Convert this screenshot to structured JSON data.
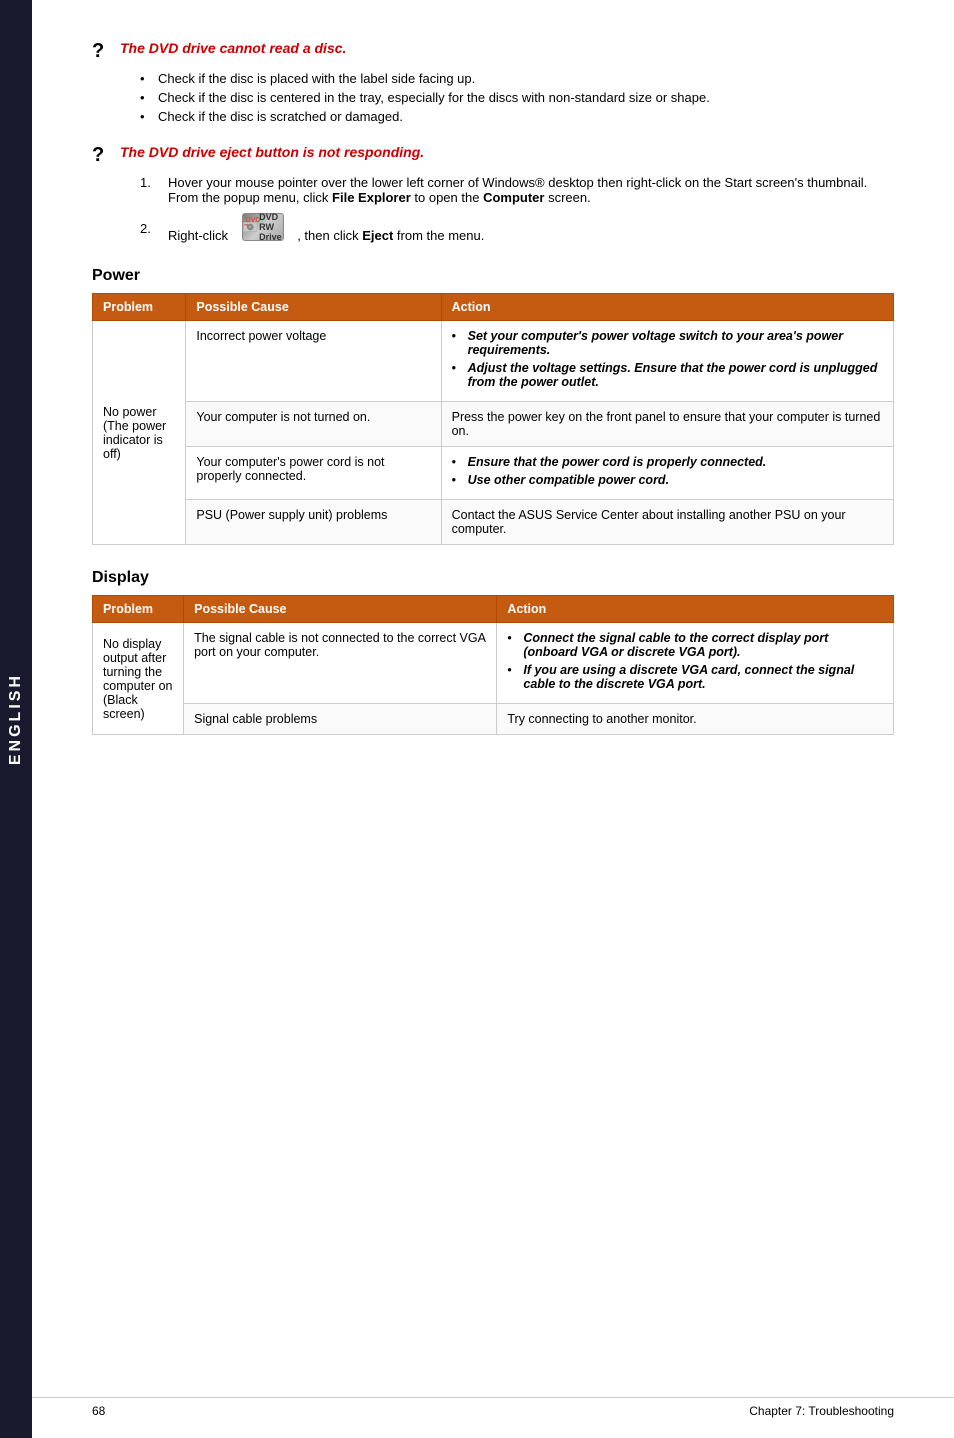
{
  "sidebar": {
    "label": "ENGLISH"
  },
  "dvd_cannot_read": {
    "question_mark": "?",
    "title": "The DVD drive cannot read a disc.",
    "bullets": [
      "Check if the disc is placed with the label side facing up.",
      "Check if the disc is centered in the tray, especially for the discs with non-standard size or shape.",
      "Check if the disc is scratched or damaged."
    ]
  },
  "dvd_eject": {
    "question_mark": "?",
    "title": "The DVD drive eject button is not responding.",
    "steps": [
      {
        "num": "1.",
        "text_before": "Hover your mouse pointer over the lower left corner of Windows® desktop then right-click on the Start screen's thumbnail. From the popup menu, click ",
        "bold1": "File Explorer",
        "text_mid": " to open the ",
        "bold2": "Computer",
        "text_after": " screen."
      },
      {
        "num": "2.",
        "text_before": "Right-click ",
        "icon": "dvd",
        "icon_label": "DVD RW Drive",
        "text_after": ", then click ",
        "bold": "Eject",
        "text_end": " from the menu."
      }
    ]
  },
  "power_section": {
    "title": "Power",
    "headers": [
      "Problem",
      "Possible Cause",
      "Action"
    ],
    "rows": [
      {
        "problem": "No power\n(The power\nindicator is off)",
        "causes": [
          {
            "cause": "Incorrect power voltage",
            "action_bullets": [
              "Set your computer's power voltage switch to your area's power requirements.",
              "Adjust the voltage settings. Ensure that the power cord is unplugged from the power outlet."
            ],
            "action_bullets_italic": [
              false,
              true
            ]
          },
          {
            "cause": "Your computer is not turned on.",
            "action_text": "Press the power key on the front panel to ensure that your computer is turned on."
          },
          {
            "cause": "Your computer's power cord is not properly connected.",
            "action_bullets": [
              "Ensure that the power cord is properly connected.",
              "Use other compatible power cord."
            ],
            "action_bullets_italic": [
              true,
              true
            ]
          },
          {
            "cause": "PSU (Power supply unit) problems",
            "action_text": "Contact the ASUS Service Center about installing another PSU on your computer."
          }
        ]
      }
    ]
  },
  "display_section": {
    "title": "Display",
    "headers": [
      "Problem",
      "Possible Cause",
      "Action"
    ],
    "rows": [
      {
        "problem": "No display\noutput after\nturning the\ncomputer on\n(Black screen)",
        "causes": [
          {
            "cause": "The signal cable is not connected to the correct VGA port on your computer.",
            "action_bullets": [
              "Connect the signal cable to the correct display port (onboard VGA or discrete VGA port).",
              "If you are using a discrete VGA card, connect the signal cable to the discrete VGA port."
            ],
            "action_bullets_italic": [
              true,
              true
            ]
          },
          {
            "cause": "Signal cable problems",
            "action_text": "Try connecting to another monitor."
          }
        ]
      }
    ]
  },
  "footer": {
    "page_num": "68",
    "chapter": "Chapter 7: Troubleshooting"
  }
}
